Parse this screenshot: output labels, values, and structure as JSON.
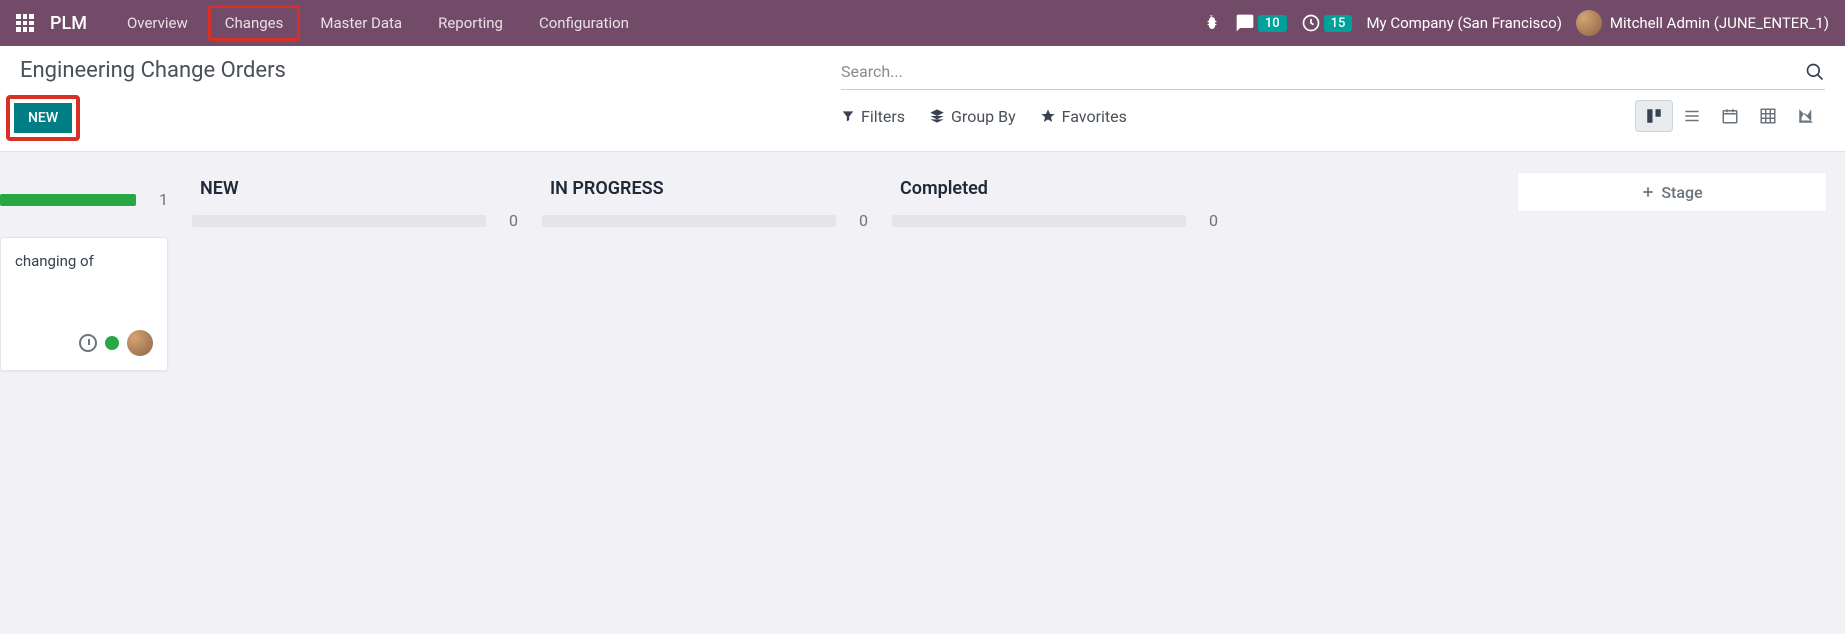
{
  "nav": {
    "brand": "PLM",
    "items": [
      "Overview",
      "Changes",
      "Master Data",
      "Reporting",
      "Configuration"
    ],
    "messages_badge": "10",
    "activities_badge": "15",
    "company": "My Company (San Francisco)",
    "user": "Mitchell Admin (JUNE_ENTER_1)"
  },
  "header": {
    "title": "Engineering Change Orders",
    "new_button": "NEW",
    "search_placeholder": "Search...",
    "filters": "Filters",
    "groupby": "Group By",
    "favorites": "Favorites"
  },
  "kanban": {
    "columns": [
      {
        "title": "",
        "count": "1",
        "progress": 100
      },
      {
        "title": "NEW",
        "count": "0",
        "progress": 0
      },
      {
        "title": "IN PROGRESS",
        "count": "0",
        "progress": 0
      },
      {
        "title": "Completed",
        "count": "0",
        "progress": 0
      }
    ],
    "card_text": "changing of",
    "add_stage": "Stage"
  }
}
